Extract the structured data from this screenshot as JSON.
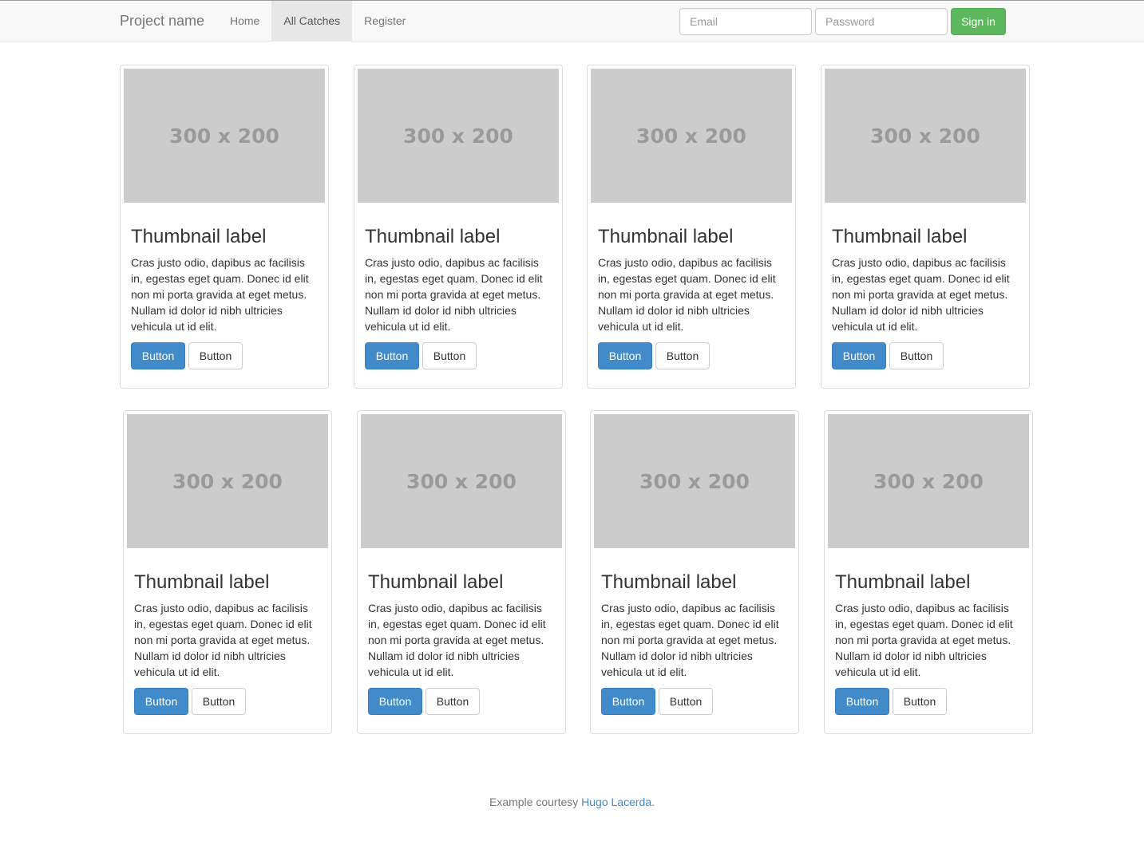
{
  "navbar": {
    "brand": "Project name",
    "items": [
      {
        "label": "Home",
        "active": false
      },
      {
        "label": "All Catches",
        "active": true
      },
      {
        "label": "Register",
        "active": false
      }
    ],
    "email_placeholder": "Email",
    "password_placeholder": "Password",
    "signin_label": "Sign in"
  },
  "thumbnails": [
    {
      "image_text": "300 x 200",
      "title": "Thumbnail label",
      "text": "Cras justo odio, dapibus ac facilisis in, egestas eget quam. Donec id elit non mi porta gravida at eget metus. Nullam id dolor id nibh ultricies vehicula ut id elit.",
      "primary_label": "Button",
      "default_label": "Button"
    },
    {
      "image_text": "300 x 200",
      "title": "Thumbnail label",
      "text": "Cras justo odio, dapibus ac facilisis in, egestas eget quam. Donec id elit non mi porta gravida at eget metus. Nullam id dolor id nibh ultricies vehicula ut id elit.",
      "primary_label": "Button",
      "default_label": "Button"
    },
    {
      "image_text": "300 x 200",
      "title": "Thumbnail label",
      "text": "Cras justo odio, dapibus ac facilisis in, egestas eget quam. Donec id elit non mi porta gravida at eget metus. Nullam id dolor id nibh ultricies vehicula ut id elit.",
      "primary_label": "Button",
      "default_label": "Button"
    },
    {
      "image_text": "300 x 200",
      "title": "Thumbnail label",
      "text": "Cras justo odio, dapibus ac facilisis in, egestas eget quam. Donec id elit non mi porta gravida at eget metus. Nullam id dolor id nibh ultricies vehicula ut id elit.",
      "primary_label": "Button",
      "default_label": "Button"
    },
    {
      "image_text": "300 x 200",
      "title": "Thumbnail label",
      "text": "Cras justo odio, dapibus ac facilisis in, egestas eget quam. Donec id elit non mi porta gravida at eget metus. Nullam id dolor id nibh ultricies vehicula ut id elit.",
      "primary_label": "Button",
      "default_label": "Button"
    },
    {
      "image_text": "300 x 200",
      "title": "Thumbnail label",
      "text": "Cras justo odio, dapibus ac facilisis in, egestas eget quam. Donec id elit non mi porta gravida at eget metus. Nullam id dolor id nibh ultricies vehicula ut id elit.",
      "primary_label": "Button",
      "default_label": "Button"
    },
    {
      "image_text": "300 x 200",
      "title": "Thumbnail label",
      "text": "Cras justo odio, dapibus ac facilisis in, egestas eget quam. Donec id elit non mi porta gravida at eget metus. Nullam id dolor id nibh ultricies vehicula ut id elit.",
      "primary_label": "Button",
      "default_label": "Button"
    },
    {
      "image_text": "300 x 200",
      "title": "Thumbnail label",
      "text": "Cras justo odio, dapibus ac facilisis in, egestas eget quam. Donec id elit non mi porta gravida at eget metus. Nullam id dolor id nibh ultricies vehicula ut id elit.",
      "primary_label": "Button",
      "default_label": "Button"
    }
  ],
  "footer": {
    "text": "Example courtesy ",
    "link_text": "Hugo Lacerda",
    "suffix": "."
  },
  "colors": {
    "primary": "#428bca",
    "success": "#5cb85c",
    "placeholder_bg": "#cccccc"
  }
}
